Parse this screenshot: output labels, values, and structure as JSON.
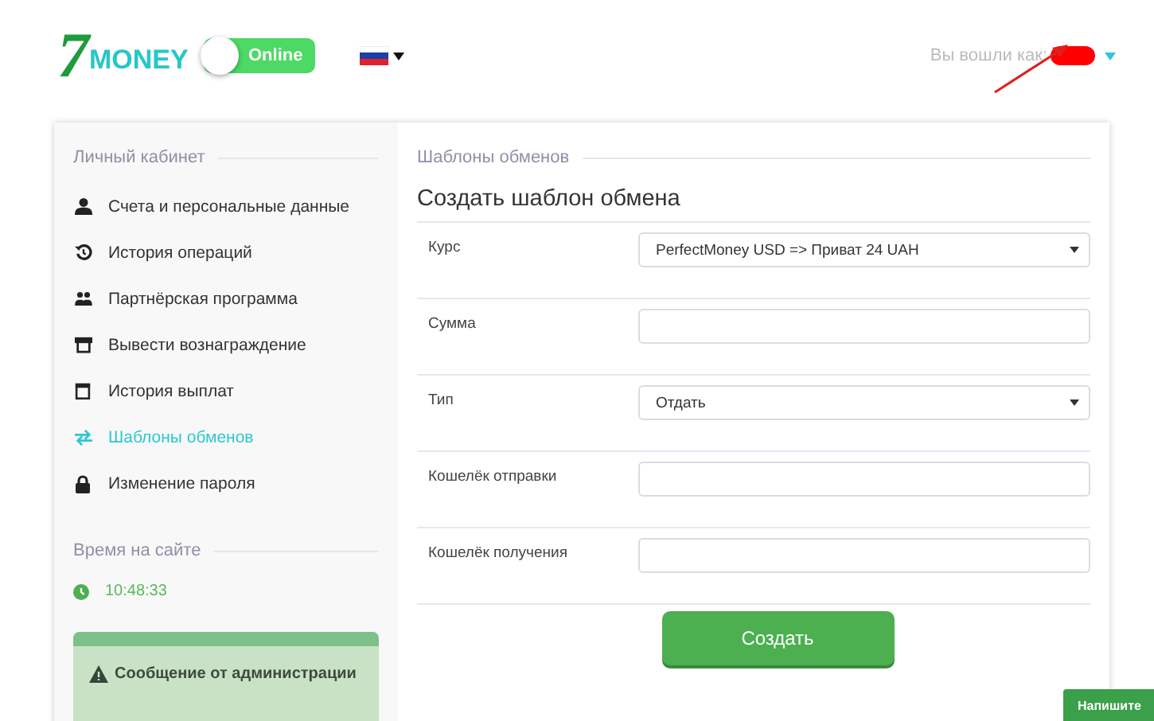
{
  "header": {
    "logo": {
      "digit": "7",
      "word": "MONEY"
    },
    "status_toggle": {
      "label": "Online",
      "on": true
    },
    "user": {
      "label": "Вы вошли как:"
    }
  },
  "sidebar": {
    "title": "Личный кабинет",
    "items": [
      {
        "label": "Счета и персональные данные",
        "selected": false
      },
      {
        "label": "История операций",
        "selected": false
      },
      {
        "label": "Партнёрская программа",
        "selected": false
      },
      {
        "label": "Вывести вознаграждение",
        "selected": false
      },
      {
        "label": "История выплат",
        "selected": false
      },
      {
        "label": "Шаблоны обменов",
        "selected": true
      },
      {
        "label": "Изменение пароля",
        "selected": false
      }
    ],
    "time_title": "Время на сайте",
    "time": "10:48:33",
    "admin_message": "Сообщение от администрации"
  },
  "content": {
    "section": "Шаблоны обменов",
    "title": "Создать шаблон обмена",
    "rows": [
      {
        "label": "Курс",
        "kind": "select",
        "value": "PerfectMoney USD => Приват 24 UAH"
      },
      {
        "label": "Сумма",
        "kind": "input"
      },
      {
        "label": "Тип",
        "kind": "select",
        "value": "Отдать"
      },
      {
        "label": "Кошелёк отправки",
        "kind": "input"
      },
      {
        "label": "Кошелёк получения",
        "kind": "input"
      }
    ],
    "submit": "Создать"
  },
  "chat_widget": "Напишите"
}
